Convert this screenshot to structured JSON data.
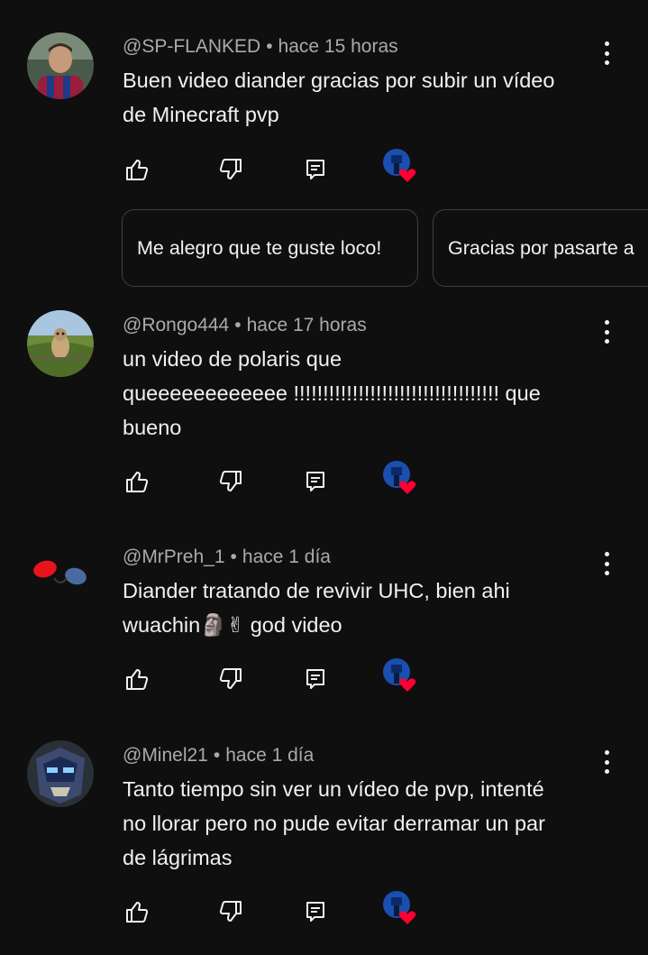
{
  "comments": [
    {
      "author": "@SP-FLANKED",
      "time": "hace 15 horas",
      "text_lines": [
        "Buen video diander gracias por subir un vídeo",
        "de Minecraft pvp"
      ],
      "avatar_icon": "footballer-avatar"
    },
    {
      "author": "@Rongo444",
      "time": "hace 17 horas",
      "text_lines": [
        "un video de polaris que",
        "queeeeeeeeeeee !!!!!!!!!!!!!!!!!!!!!!!!!!!!!!!!!!! que",
        "bueno"
      ],
      "avatar_icon": "owl-avatar"
    },
    {
      "author": "@MrPreh_1",
      "time": "hace 1 día",
      "text_lines": [
        "Diander tratando de revivir UHC, bien ahi",
        "wuachin🗿✌ god video"
      ],
      "avatar_icon": "red-eye-avatar"
    },
    {
      "author": "@Minel21",
      "time": "hace 1 día",
      "text_lines": [
        "Tanto tiempo sin ver un vídeo de pvp, intenté",
        "no llorar pero no pude evitar derramar un par",
        "de lágrimas"
      ],
      "avatar_icon": "robot-avatar"
    }
  ],
  "suggested_replies": [
    "Me alegro que te guste loco!",
    "Gracias por pasarte a"
  ],
  "colors": {
    "background": "#0f0f0f",
    "text": "#f1f1f1",
    "secondary": "#aaaaaa",
    "heart": "#ff0033",
    "chip_border": "#3f3f3f"
  },
  "icons": [
    "like-icon",
    "dislike-icon",
    "reply-icon",
    "creator-heart-icon",
    "more-options-icon"
  ]
}
